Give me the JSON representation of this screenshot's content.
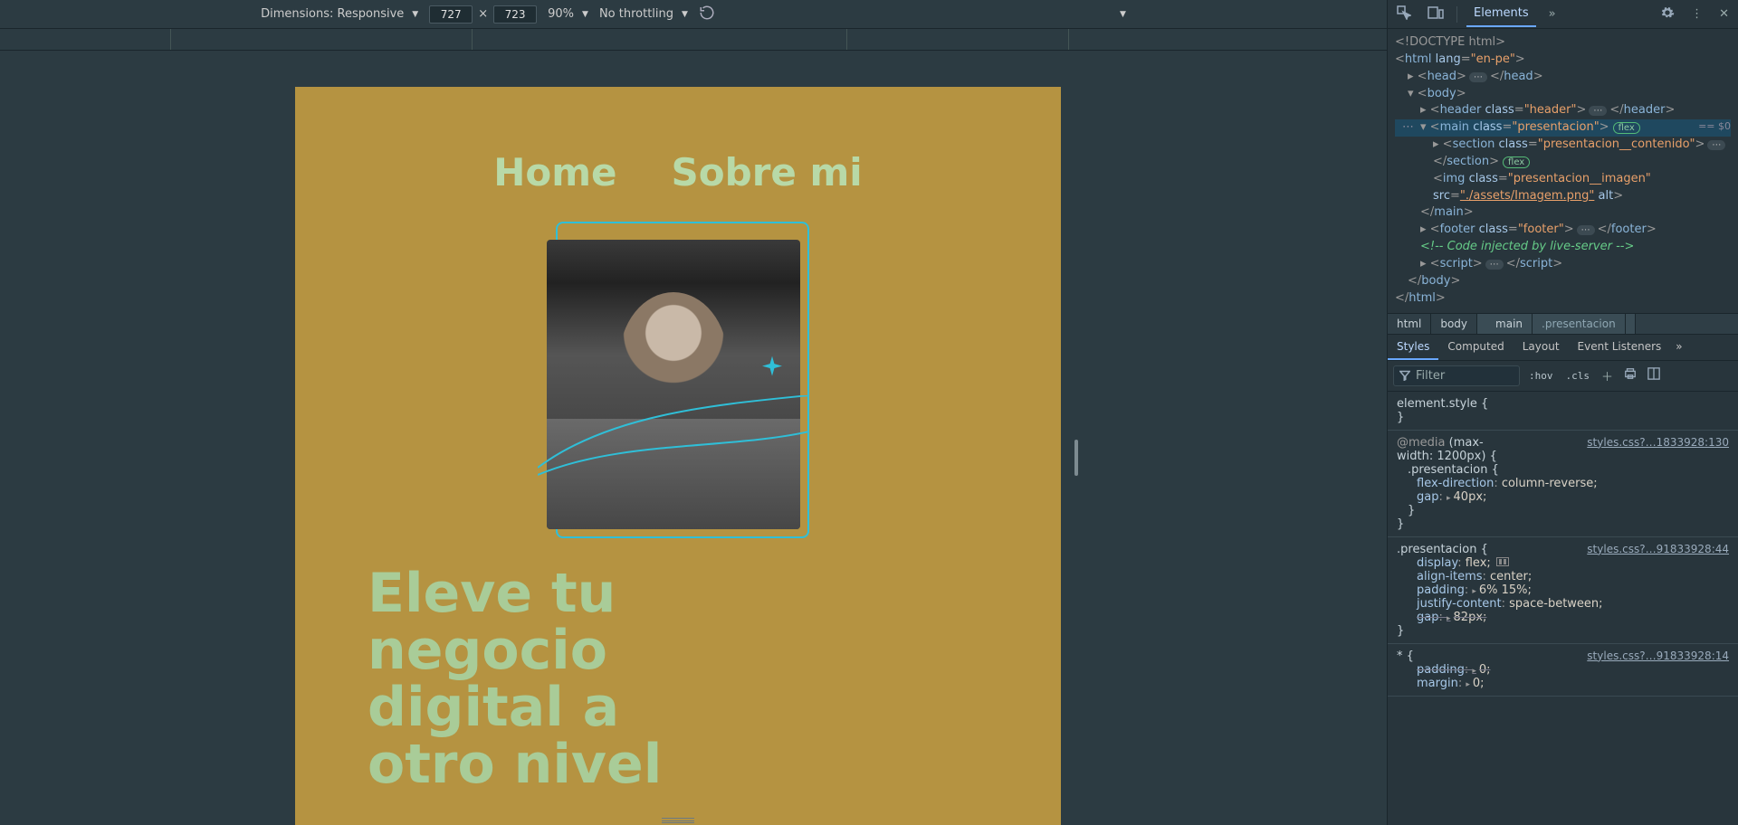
{
  "toolbar": {
    "dimensions_label": "Dimensions: Responsive",
    "width": "727",
    "height": "723",
    "x_sep": "×",
    "zoom": "90%",
    "throttling": "No throttling"
  },
  "rendered_page": {
    "nav": {
      "home": "Home",
      "about": "Sobre mi"
    },
    "headline": "Eleve tu negocio digital a otro nivel"
  },
  "panel": {
    "tabs": {
      "elements": "Elements"
    },
    "dom": {
      "doctype": "<!DOCTYPE html>",
      "html_open": "html",
      "html_lang_attr": "lang",
      "html_lang_val": "\"en-pe\"",
      "head": "head",
      "body": "body",
      "header": "header",
      "header_class_val": "\"header\"",
      "main": "main",
      "main_class_val": "\"presentacion\"",
      "section": "section",
      "section_class_val": "\"presentacion__contenido\"",
      "img": "img",
      "img_class_val": "\"presentacion__imagen\"",
      "img_src_attr": "src",
      "img_src_val": "\"./assets/Imagem.png\"",
      "img_alt_attr": "alt",
      "footer": "footer",
      "footer_class_val": "\"footer\"",
      "comment": "<!-- Code injected by live-server -->",
      "script": "script",
      "class_attr": "class",
      "flex_pill": "flex",
      "sel_trail": "== $0"
    },
    "crumbs": {
      "html": "html",
      "body": "body",
      "main_pre": "main",
      "main_sel": ".presentacion"
    },
    "styles_tabs": {
      "styles": "Styles",
      "computed": "Computed",
      "layout": "Layout",
      "listeners": "Event Listeners"
    },
    "styles_toolbar": {
      "filter": "Filter",
      "hov": ":hov",
      "cls": ".cls"
    },
    "rules": {
      "element_style": "element.style {",
      "brace_close": "}",
      "media": "@media",
      "media_cond1": "(max-",
      "media_cond2": "width: 1200px) {",
      "src1": "styles.css?…1833928:130",
      "r1_sel": ".presentacion {",
      "r1_p1": "flex-direction",
      "r1_v1": "column-reverse;",
      "r1_p2": "gap",
      "r1_v2": "40px;",
      "src2": "styles.css?…91833928:44",
      "r2_sel": ".presentacion {",
      "r2_p1": "display",
      "r2_v1": "flex;",
      "r2_p2": "align-items",
      "r2_v2": "center;",
      "r2_p3": "padding",
      "r2_v3": "6% 15%;",
      "r2_p4": "justify-content",
      "r2_v4": "space-between;",
      "r2_p5": "gap",
      "r2_v5": "82px;",
      "src3": "styles.css?…91833928:14",
      "r3_sel": "* {",
      "r3_p1": "padding",
      "r3_v1": "0;",
      "r3_p2": "margin",
      "r3_v2": "0;"
    }
  }
}
